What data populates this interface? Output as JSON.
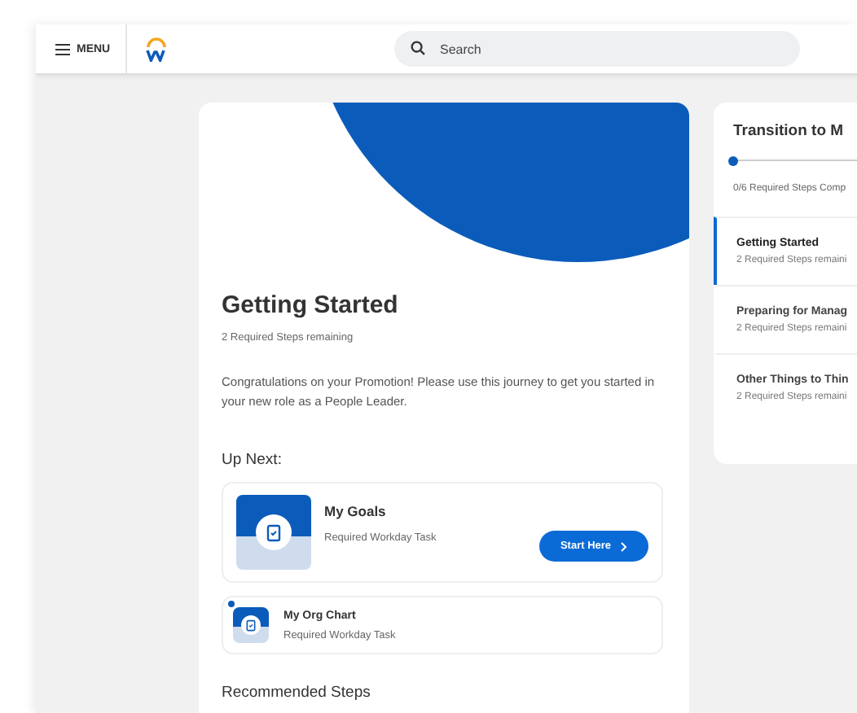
{
  "header": {
    "menu_label": "MENU",
    "search": {
      "placeholder": "Search"
    }
  },
  "journey": {
    "title": "Getting Started",
    "subtitle": "2 Required Steps remaining",
    "description": "Congratulations on your Promotion! Please use this journey to get you started in your new role as a People Leader.",
    "up_next_heading": "Up Next:",
    "tasks": [
      {
        "kind": "featured",
        "title": "My Goals",
        "subtitle": "Required Workday Task",
        "button": "Start Here"
      },
      {
        "kind": "compact",
        "title": "My Org Chart",
        "subtitle": "Required Workday Task"
      }
    ],
    "recommended_heading": "Recommended Steps"
  },
  "sidebar": {
    "title": "Transition to M",
    "progress": {
      "level": 0
    },
    "progress_text": "0/6 Required Steps Comp",
    "items": [
      {
        "title": "Getting Started",
        "subtitle": "2 Required Steps remaini",
        "selected": true
      },
      {
        "title": "Preparing for Manag",
        "subtitle": "2 Required Steps remaini",
        "selected": false
      },
      {
        "title": "Other Things to Thin",
        "subtitle": "2 Required Steps remaini",
        "selected": false
      }
    ]
  }
}
